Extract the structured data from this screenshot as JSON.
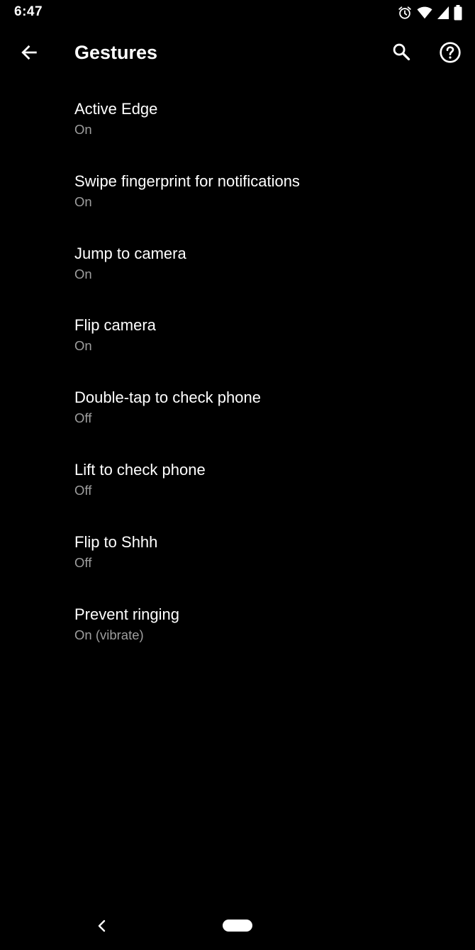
{
  "status_bar": {
    "time": "6:47",
    "icons": [
      "alarm-icon",
      "wifi-icon",
      "cellular-signal-icon",
      "battery-icon"
    ]
  },
  "app_bar": {
    "title": "Gestures",
    "back_icon": "arrow-back-icon",
    "search_icon": "search-icon",
    "help_icon": "help-icon"
  },
  "settings": {
    "items": [
      {
        "title": "Active Edge",
        "summary": "On"
      },
      {
        "title": "Swipe fingerprint for notifications",
        "summary": "On"
      },
      {
        "title": "Jump to camera",
        "summary": "On"
      },
      {
        "title": "Flip camera",
        "summary": "On"
      },
      {
        "title": "Double-tap to check phone",
        "summary": "Off"
      },
      {
        "title": "Lift to check phone",
        "summary": "Off"
      },
      {
        "title": "Flip to Shhh",
        "summary": "Off"
      },
      {
        "title": "Prevent ringing",
        "summary": "On (vibrate)"
      }
    ]
  },
  "nav_bar": {
    "back_icon": "chevron-left-icon",
    "home_icon": "home-pill-icon"
  },
  "colors": {
    "background": "#000000",
    "primary_text": "#ffffff",
    "secondary_text": "#9e9e9e"
  }
}
